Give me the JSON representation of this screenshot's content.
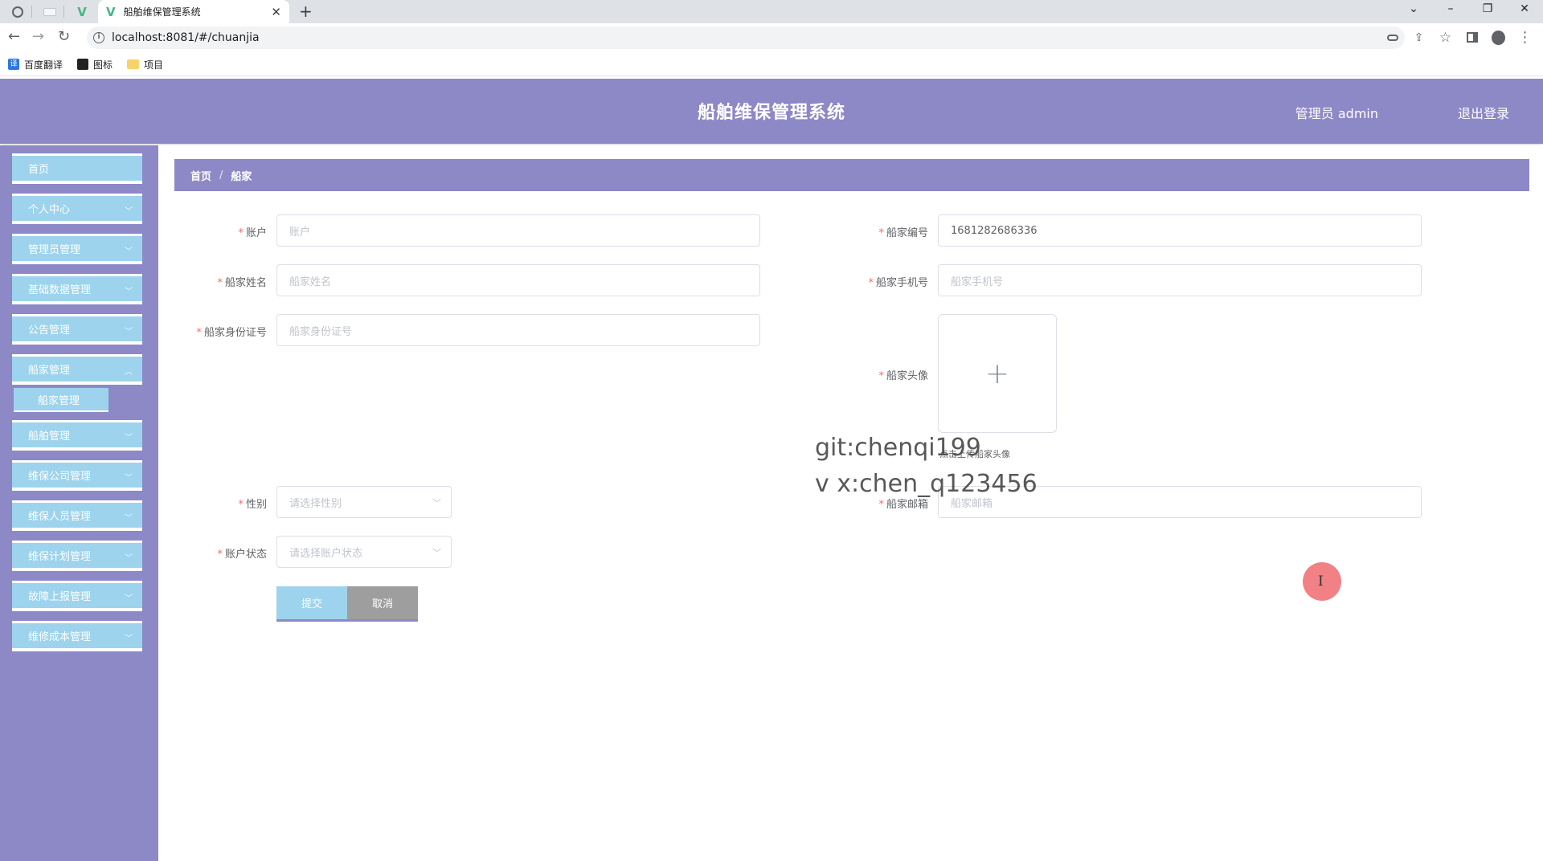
{
  "browser": {
    "tab_title": "船舶维保管理系统",
    "url": "localhost:8081/#/chuanjia",
    "bookmarks": [
      "百度翻译",
      "图标",
      "项目"
    ],
    "bookmark_icon_letter": "译"
  },
  "header": {
    "title": "船舶维保管理系统",
    "user": "管理员 admin",
    "logout": "退出登录"
  },
  "sidebar": {
    "items": [
      {
        "label": "首页"
      },
      {
        "label": "个人中心"
      },
      {
        "label": "管理员管理"
      },
      {
        "label": "基础数据管理"
      },
      {
        "label": "公告管理"
      },
      {
        "label": "船家管理"
      },
      {
        "label": "船舶管理"
      },
      {
        "label": "维保公司管理"
      },
      {
        "label": "维保人员管理"
      },
      {
        "label": "维保计划管理"
      },
      {
        "label": "故障上报管理"
      },
      {
        "label": "维修成本管理"
      }
    ],
    "sub_item": "船家管理"
  },
  "breadcrumb": {
    "home": "首页",
    "separator": "/",
    "current": "船家"
  },
  "form": {
    "account": {
      "label": "账户",
      "placeholder": "账户"
    },
    "code": {
      "label": "船家编号",
      "value": "1681282686336"
    },
    "name": {
      "label": "船家姓名",
      "placeholder": "船家姓名"
    },
    "phone": {
      "label": "船家手机号",
      "placeholder": "船家手机号"
    },
    "id_card": {
      "label": "船家身份证号",
      "placeholder": "船家身份证号"
    },
    "avatar": {
      "label": "船家头像",
      "tip": "点击上传船家头像",
      "plus": "+"
    },
    "gender": {
      "label": "性别",
      "placeholder": "请选择性别"
    },
    "email": {
      "label": "船家邮箱",
      "placeholder": "船家邮箱"
    },
    "status": {
      "label": "账户状态",
      "placeholder": "请选择账户状态"
    },
    "required_mark": "*",
    "submit": "提交",
    "cancel": "取消"
  },
  "watermark": {
    "line1": "git:chenqi199",
    "line2": "v x:chen_q123456"
  },
  "colors": {
    "header_bg": "#8d88c6",
    "menu_bg": "#9dd3ec",
    "required": "#f56c6c"
  }
}
